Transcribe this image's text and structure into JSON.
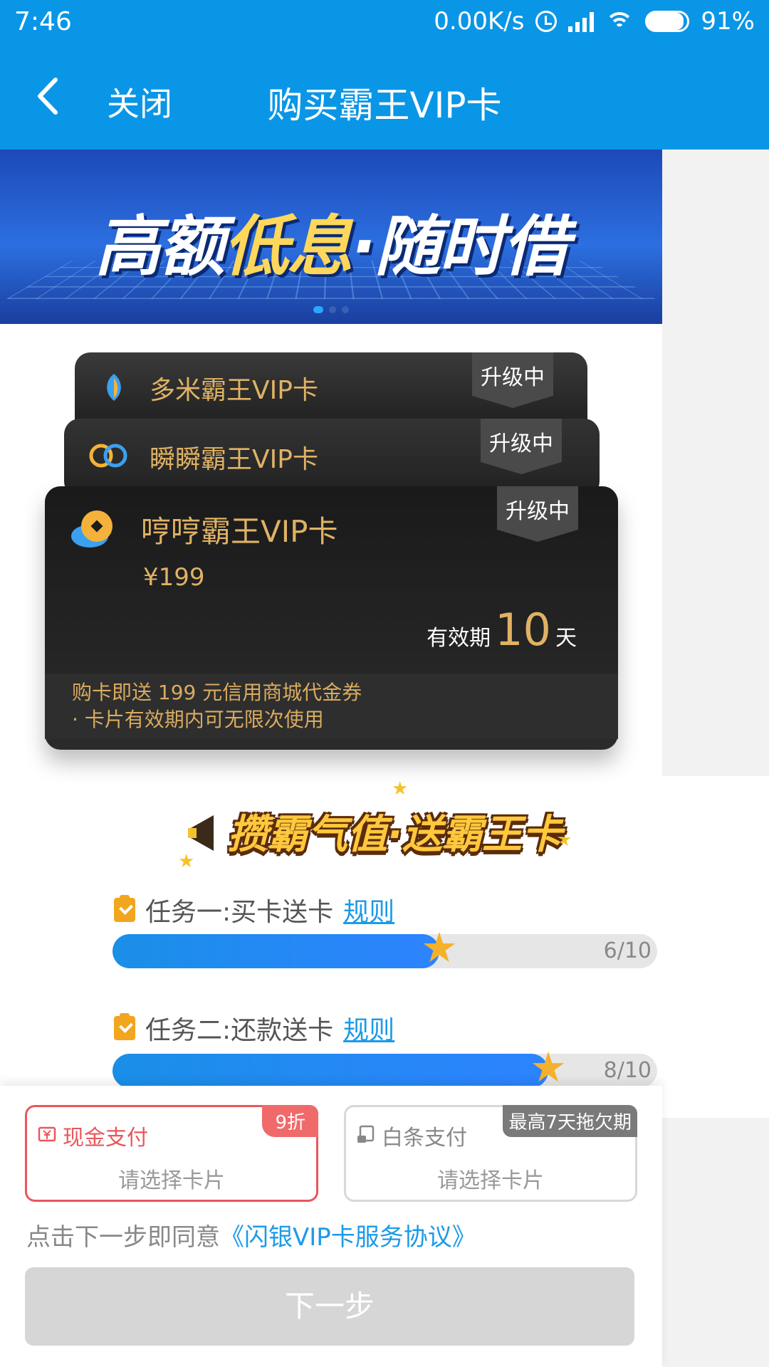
{
  "status_bar": {
    "time": "7:46",
    "speed": "0.00K/s",
    "battery": "91%"
  },
  "header": {
    "close_label": "关闭",
    "title": "购买霸王VIP卡"
  },
  "banner": {
    "text_a": "高额",
    "text_b": "低息",
    "text_c": "·随时借"
  },
  "cards": [
    {
      "name": "多米霸王VIP卡",
      "badge": "升级中"
    },
    {
      "name": "瞬瞬霸王VIP卡",
      "badge": "升级中"
    },
    {
      "name": "哼哼霸王VIP卡",
      "badge": "升级中",
      "price": "¥199",
      "validity_prefix": "有效期",
      "validity_days": "10",
      "validity_suffix": "天",
      "perk_1": "购卡即送 199 元信用商城代金券",
      "perk_2": "· 卡片有效期内可无限次使用"
    }
  ],
  "promo": {
    "text": "攒霸气值·送霸王卡"
  },
  "tasks": [
    {
      "title": "任务一:买卡送卡",
      "rule": "规则",
      "progress_text": "6/10",
      "progress": 0.6
    },
    {
      "title": "任务二:还款送卡",
      "rule": "规则",
      "progress_text": "8/10",
      "progress": 0.8
    }
  ],
  "payment": {
    "cash": {
      "label": "现金支付",
      "sub": "请选择卡片",
      "tag": "9折"
    },
    "credit": {
      "label": "白条支付",
      "sub": "请选择卡片",
      "tag": "最高7天拖欠期"
    }
  },
  "agreement": {
    "prefix": "点击下一步即同意",
    "link": "《闪银VIP卡服务协议》"
  },
  "next_button": "下一步",
  "colors": {
    "brand_blue": "#0a96e6",
    "gold": "#e0b264",
    "cash_red": "#e9575b",
    "progress_blue": "#1a8fe8"
  }
}
